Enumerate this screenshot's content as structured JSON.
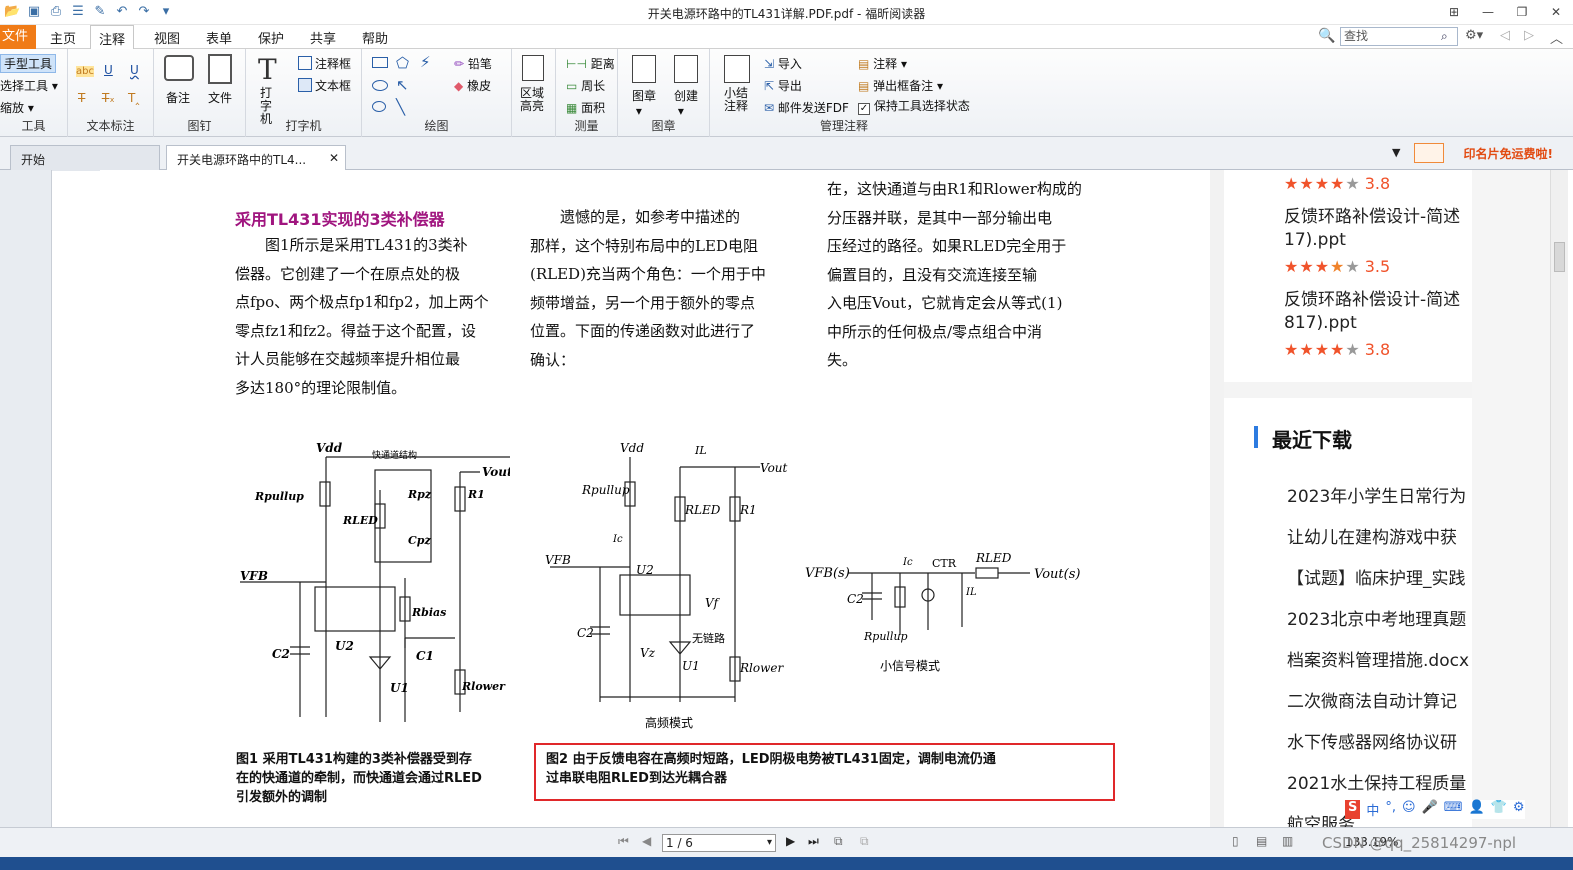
{
  "window": {
    "title": "开关电源环路中的TL431详解.PDF.pdf - 福昕阅读器"
  },
  "menu": {
    "file": "文件",
    "items": [
      "主页",
      "注释",
      "视图",
      "表单",
      "保护",
      "共享",
      "帮助"
    ],
    "active": "注释",
    "search_placeholder": "查找"
  },
  "ribbon": {
    "tools": {
      "hand": "手型工具",
      "select": "选择工具",
      "zoom": "缩放",
      "label": "工具"
    },
    "text_markup": {
      "label": "文本标注",
      "abc": "abc"
    },
    "pin": {
      "note": "备注",
      "file": "文件",
      "label": "图钉"
    },
    "typewriter": {
      "typewriter": "打字机",
      "callout": "注释框",
      "textbox": "文本框",
      "label": "打字机"
    },
    "drawing": {
      "pencil": "铅笔",
      "eraser": "橡皮",
      "area_highlight": "区域高亮",
      "label": "绘图"
    },
    "measure": {
      "distance": "距离",
      "perimeter": "周长",
      "area": "面积",
      "label": "测量"
    },
    "stamp": {
      "stamp": "图章",
      "create": "创建",
      "label": "图章"
    },
    "manage": {
      "summary": "小结注释",
      "import": "导入",
      "export": "导出",
      "email": "邮件发送FDF",
      "comments": "注释",
      "popup": "弹出框备注",
      "keep_tool": "保持工具选择状态",
      "label": "管理注释"
    }
  },
  "tabs": {
    "start": "开始",
    "doc": "开关电源环路中的TL4...",
    "promo": "印名片免运费啦!"
  },
  "document": {
    "heading": "采用TL431实现的3类补偿器",
    "col1": [
      "图1所示是采用TL431的3类补",
      "偿器。它创建了一个在原点处的极",
      "点fpo、两个极点fp1和fp2，加上两个",
      "零点fz1和fz2。得益于这个配置，设",
      "计人员能够在交越频率提升相位最",
      "多达180°的理论限制值。"
    ],
    "col2": [
      "遗憾的是，如参考中描述的",
      "那样，这个特别布局中的LED电阻",
      "(RLED)充当两个角色：一个用于中",
      "频带增益，另一个用于额外的零点",
      "位置。下面的传递函数对此进行了",
      "确认："
    ],
    "col3": [
      "在，这快通道与由R1和Rlower构成的",
      "分压器并联，是其中一部分输出电",
      "压经过的路径。如果RLED完全用于",
      "偏置目的，且没有交流连接至输",
      "入电压Vout，它就肯定会从等式(1)",
      "中所示的任何极点/零点组合中消",
      "失。"
    ],
    "fig1_caption": [
      "图1 采用TL431构建的3类补偿器受到存",
      "在的快通道的牵制，而快通道会通过RLED",
      "引发额外的调制"
    ],
    "fig2_caption": [
      "图2 由于反馈电容在高频时短路，LED阴极电势被TL431固定，调制电流仍通",
      "过串联电阻RLED到达光耦合器"
    ],
    "fig1_labels": {
      "vdd": "Vdd",
      "fast": "快通道结构",
      "vout": "Vout",
      "rpullup": "Rpullup",
      "rled": "RLED",
      "rpz": "Rpz",
      "cpz": "Cpz",
      "r1": "R1",
      "vfb": "VFB",
      "rbias": "Rbias",
      "u2": "U2",
      "c2": "C2",
      "c1": "C1",
      "u1": "U1",
      "rlower": "Rlower"
    },
    "fig2_labels": {
      "vdd": "Vdd",
      "il": "IL",
      "vout": "Vout",
      "rpullup": "Rpullup",
      "rled": "RLED",
      "r1": "R1",
      "ic": "Ic",
      "vfb": "VFB",
      "u2": "U2",
      "vf": "Vf",
      "c2": "C2",
      "nochain": "无链路",
      "vz": "Vz",
      "u1": "U1",
      "rlower": "Rlower",
      "hf": "高频模式"
    },
    "fig3_labels": {
      "vfb": "VFB(s)",
      "ic": "Ic",
      "ctr": "CTR",
      "rled": "RLED",
      "vout": "Vout(s)",
      "c2": "C2",
      "il": "IL",
      "rpullup": "Rpullup",
      "ss": "小信号模式"
    }
  },
  "right_panel": {
    "items": [
      {
        "title": "",
        "rating": "3.8",
        "stars": 4
      },
      {
        "title": "反馈环路补偿设计-简述",
        "sub": "17).ppt",
        "rating": "3.5",
        "stars": 3.5
      },
      {
        "title": "反馈环路补偿设计-简述",
        "sub": "817).ppt",
        "rating": "3.8",
        "stars": 4
      }
    ],
    "recent_title": "最近下载",
    "recent": [
      "2023年小学生日常行为",
      "让幼儿在建构游戏中获",
      "【试题】临床护理_实践",
      "2023北京中考地理真题",
      "档案资料管理措施.docx",
      "二次微商法自动计算记",
      "水下传感器网络协议研",
      "2021水土保持工程质量",
      "航空服务"
    ]
  },
  "status": {
    "page": "1 / 6",
    "zoom": "133.19%",
    "watermark": "CSDN @qq_25814297-npl"
  }
}
